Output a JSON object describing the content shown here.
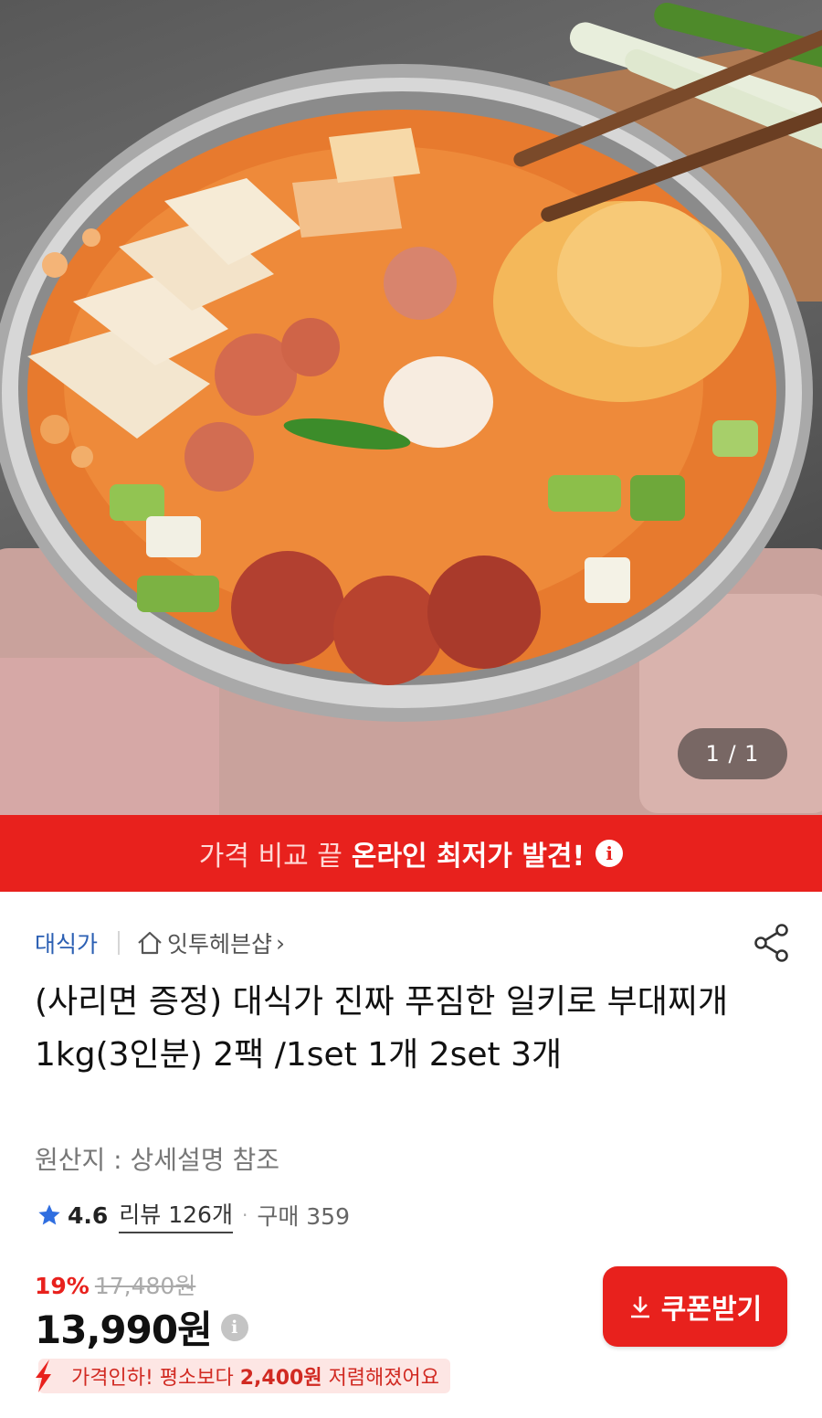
{
  "hero": {
    "image_description_icon": "budae-jjigae-photo",
    "page_indicator": "1 / 1"
  },
  "banner": {
    "light_text": "가격 비교 끝",
    "bold_text": "온라인 최저가 발견!",
    "icon": "info-icon"
  },
  "product": {
    "brand": "대식가",
    "store": "잇투헤븐샵",
    "store_chevron": "›",
    "title": "(사리면 증정) 대식가 진짜 푸짐한 일키로 부대찌개 1kg(3인분) 2팩 /1set 1개 2set 3개",
    "origin": "원산지 : 상세설명 참조",
    "rating": "4.6",
    "review_text": "리뷰 126개",
    "purchase_text": "구매 359",
    "discount_rate": "19%",
    "original_price": "17,480원",
    "price": "13,990원",
    "price_drop_prefix": "가격인하! 평소보다",
    "price_drop_amount": "2,400원",
    "price_drop_suffix": "저렴해졌어요",
    "coupon_button": "쿠폰받기"
  },
  "colors": {
    "accent": "#e8211d",
    "brand_link": "#2b5fb3",
    "star": "#2f6ee0"
  }
}
